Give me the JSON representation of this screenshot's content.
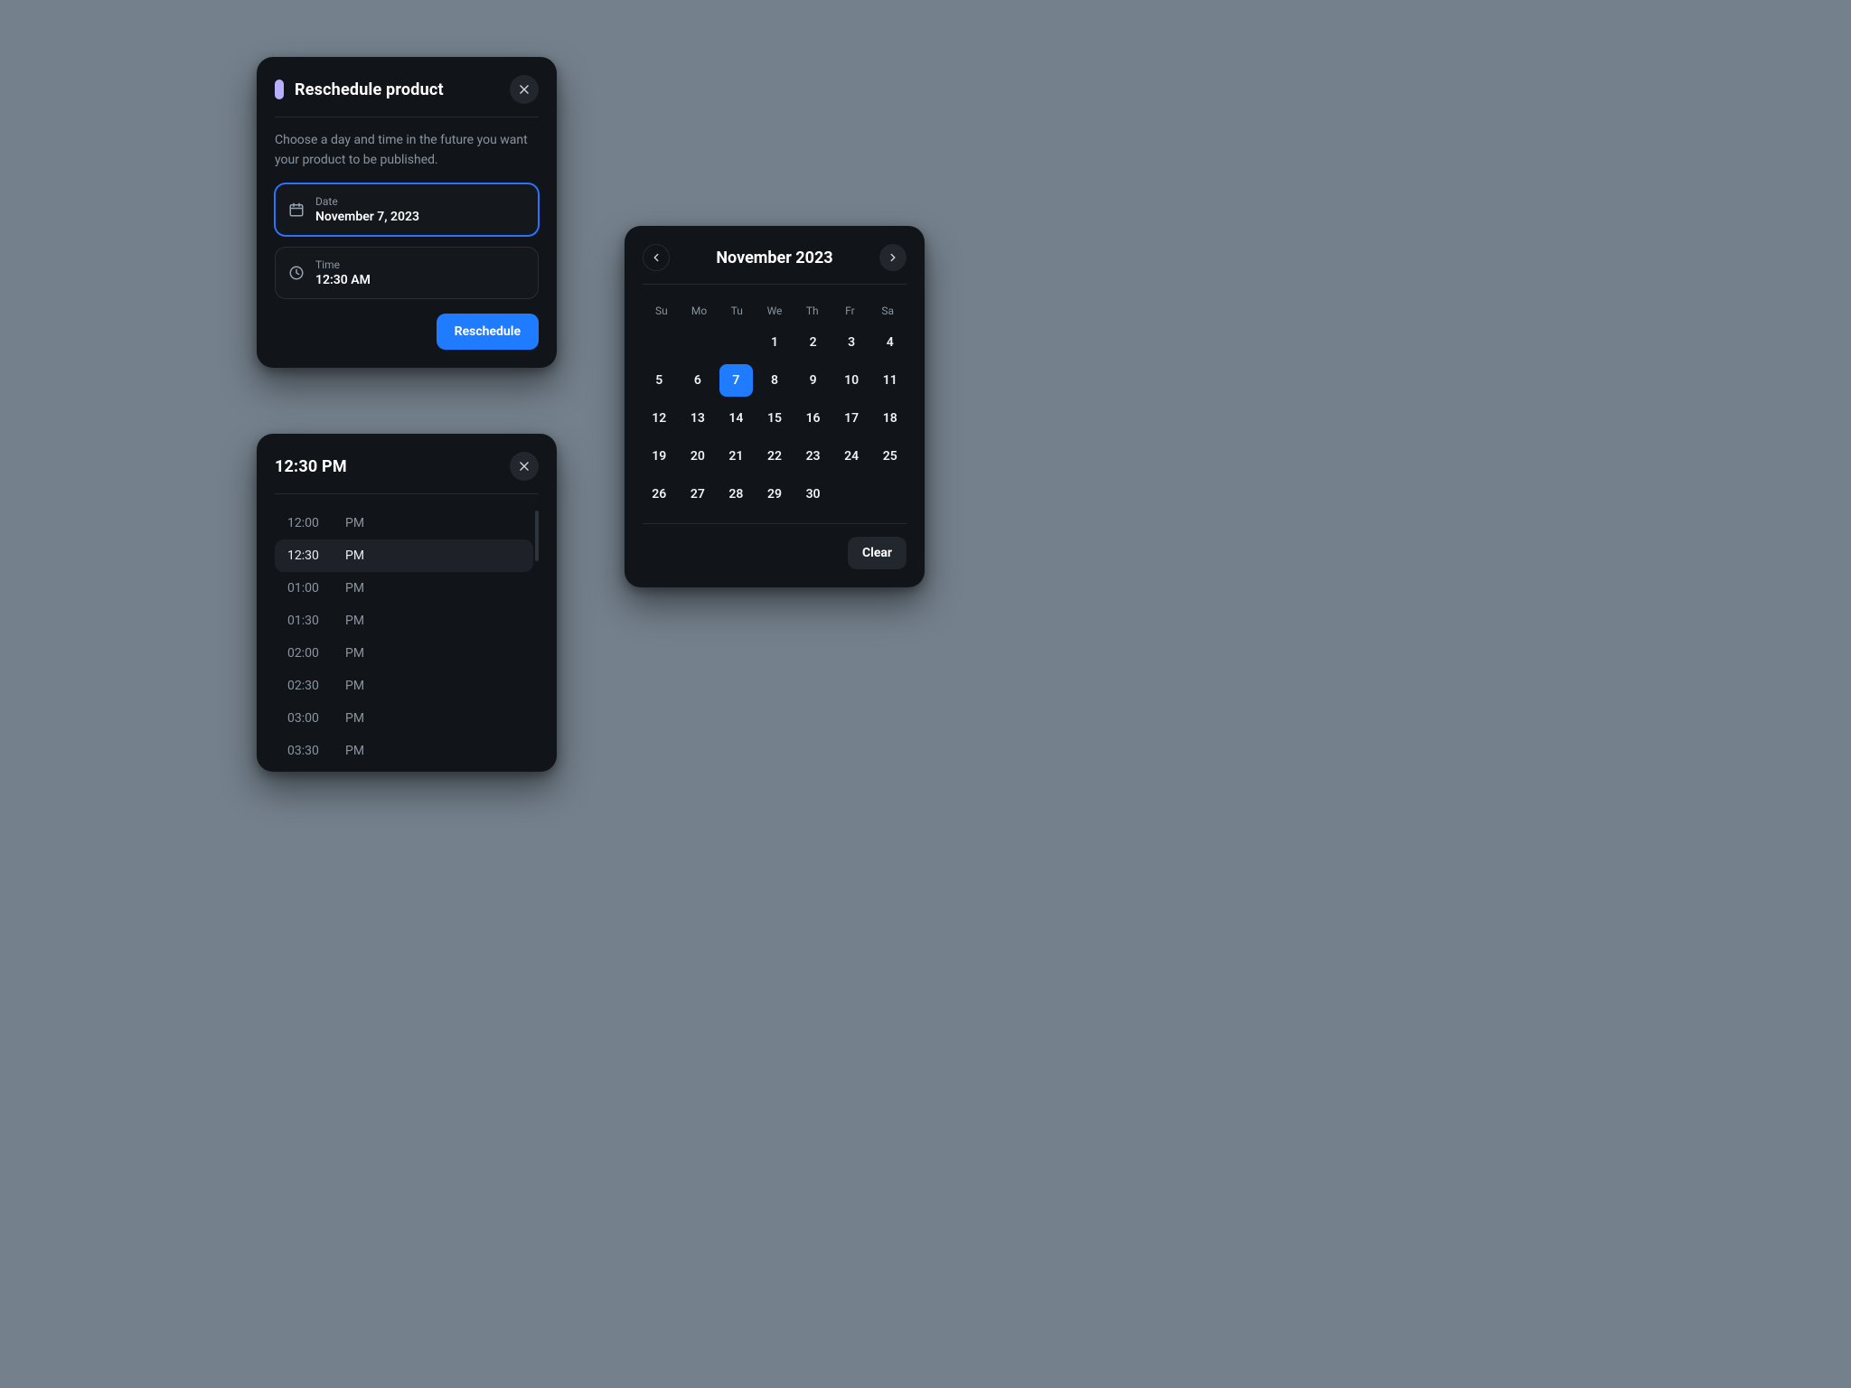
{
  "reschedule": {
    "title": "Reschedule product",
    "desc": "Choose a day and time in the future you want your product to be published.",
    "date_label": "Date",
    "date_value": "November 7, 2023",
    "time_label": "Time",
    "time_value": "12:30 AM",
    "action": "Reschedule"
  },
  "timepicker": {
    "title": "12:30 PM",
    "selected": "12:30",
    "items": [
      {
        "hh": "12:00",
        "ap": "PM"
      },
      {
        "hh": "12:30",
        "ap": "PM"
      },
      {
        "hh": "01:00",
        "ap": "PM"
      },
      {
        "hh": "01:30",
        "ap": "PM"
      },
      {
        "hh": "02:00",
        "ap": "PM"
      },
      {
        "hh": "02:30",
        "ap": "PM"
      },
      {
        "hh": "03:00",
        "ap": "PM"
      },
      {
        "hh": "03:30",
        "ap": "PM"
      }
    ]
  },
  "calendar": {
    "month_label": "November 2023",
    "weekdays": [
      "Su",
      "Mo",
      "Tu",
      "We",
      "Th",
      "Fr",
      "Sa"
    ],
    "lead_blanks": 3,
    "days_in_month": 30,
    "selected_day": 7,
    "clear_label": "Clear"
  },
  "colors": {
    "accent": "#1f7bff",
    "accent2": "#b7b0ff"
  }
}
